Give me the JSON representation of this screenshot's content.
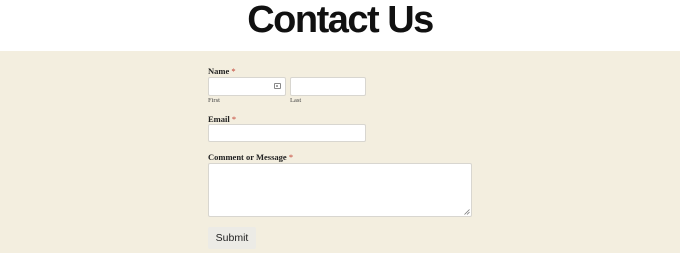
{
  "page": {
    "title": "Contact Us"
  },
  "form": {
    "name": {
      "label": "Name",
      "required_mark": "*",
      "first_value": "",
      "last_value": "",
      "first_sublabel": "First",
      "last_sublabel": "Last"
    },
    "email": {
      "label": "Email",
      "required_mark": "*",
      "value": ""
    },
    "comment": {
      "label": "Comment or Message",
      "required_mark": "*",
      "value": ""
    },
    "submit_label": "Submit"
  },
  "colors": {
    "background": "#f3eedf",
    "header_background": "#ffffff",
    "required": "#c0392b",
    "button_background": "#ecebe6"
  },
  "icons": {
    "name_field": "contact-card-icon",
    "textarea_corner": "resize-handle-icon"
  }
}
